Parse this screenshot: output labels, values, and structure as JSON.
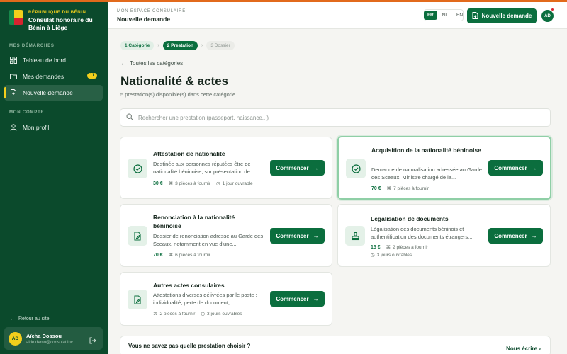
{
  "sidebar": {
    "brand": {
      "country": "RÉPUBLIQUE DU BÉNIN",
      "name": "Consulat honoraire du Bénin à Liège"
    },
    "section1": "MES DÉMARCHES",
    "items": [
      {
        "label": "Tableau de bord",
        "icon": "dashboard-icon"
      },
      {
        "label": "Mes demandes",
        "icon": "folder-icon",
        "badge": "11"
      },
      {
        "label": "Nouvelle demande",
        "icon": "new-document-icon",
        "active": true
      }
    ],
    "section2": "MON COMPTE",
    "profile": {
      "label": "Mon profil",
      "icon": "user-icon"
    },
    "back": "Retour au site",
    "user": {
      "initials": "AD",
      "name": "Aïcha Dossou",
      "email": "aide.demo@consulat.inv..."
    }
  },
  "header": {
    "kicker": "MON ESPACE CONSULAIRE",
    "title": "Nouvelle demande",
    "languages": [
      "FR",
      "NL",
      "EN"
    ],
    "active_language": "FR",
    "new_button": "Nouvelle demande",
    "avatar": "AD"
  },
  "steps": [
    {
      "label": "1  Catégorie",
      "state": "done"
    },
    {
      "label": "2  Prestation",
      "state": "active"
    },
    {
      "label": "3  Dossier",
      "state": "todo"
    }
  ],
  "back_link": "Toutes les catégories",
  "page": {
    "title": "Nationalité & actes",
    "subtitle": "5 prestation(s) disponible(s) dans cette catégorie."
  },
  "search": {
    "placeholder": "Rechercher une prestation (passeport, naissance...)"
  },
  "cards": [
    {
      "title": "Attestation de nationalité",
      "desc": "Destinée aux personnes réputées être de nationalité béninoise, sur présentation de...",
      "price": "30 €",
      "pieces": "3 pièces à fournir",
      "delay": "1 jour ouvrable",
      "button": "Commencer",
      "icon": "check-circle-icon"
    },
    {
      "title": "Acquisition de la nationalité béninoise",
      "desc": "Demande de naturalisation adressée au Garde des Sceaux, Ministre chargé de la...",
      "price": "70 €",
      "pieces": "7 pièces à fournir",
      "delay": "",
      "button": "Commencer",
      "icon": "check-circle-icon"
    },
    {
      "title": "Renonciation à la nationalité béninoise",
      "desc": "Dossier de renonciation adressé au Garde des Sceaux, notamment en vue d'une...",
      "price": "70 €",
      "pieces": "6 pièces à fournir",
      "delay": "",
      "button": "Commencer",
      "icon": "edit-document-icon"
    },
    {
      "title": "Légalisation de documents",
      "desc": "Légalisation des documents béninois et authentification des documents étrangers...",
      "price": "15 €",
      "pieces": "2 pièces à fournir",
      "delay": "3 jours ouvrables",
      "button": "Commencer",
      "icon": "stamp-icon"
    },
    {
      "title": "Autres actes consulaires",
      "desc": "Attestations diverses délivrées par le poste : individualité, perte de document,...",
      "price": "",
      "pieces": "2 pièces à fournir",
      "delay": "3 jours ouvrables",
      "button": "Commencer",
      "icon": "edit-document-icon"
    }
  ],
  "help": {
    "question": "Vous ne savez pas quelle prestation choisir ?",
    "link": "Nous écrire"
  },
  "colors": {
    "primary": "#0b6e3e",
    "sidebar": "#0b4a2c",
    "accent": "#f2cf1c",
    "alert": "#d7232f"
  }
}
